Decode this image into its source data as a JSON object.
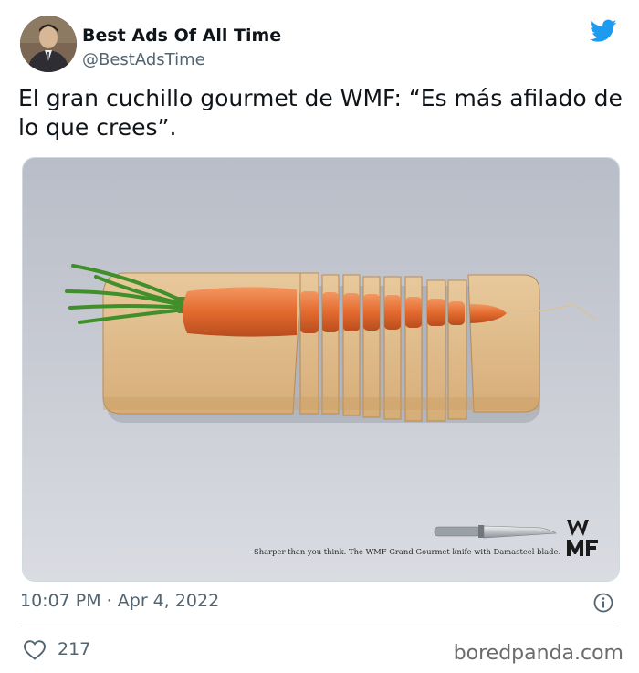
{
  "author": {
    "name": "Best Ads Of All Time",
    "handle": "@BestAdsTime"
  },
  "tweet": {
    "text": "El gran cuchillo gourmet de WMF: “Es más afilado de lo que crees”."
  },
  "media": {
    "ad_caption": "Sharper than you think. The WMF Grand Gourmet knife with Damasteel blade.",
    "brand_logo_text": "WMF"
  },
  "meta": {
    "timestamp": "10:07 PM · Apr 4, 2022"
  },
  "footer": {
    "like_count": "217",
    "watermark": "boredpanda.com"
  },
  "colors": {
    "twitter_blue": "#1d9bf0",
    "secondary_text": "#536471",
    "divider": "#cfd9de"
  },
  "icons": [
    "twitter-bird-icon",
    "info-icon",
    "heart-icon"
  ]
}
